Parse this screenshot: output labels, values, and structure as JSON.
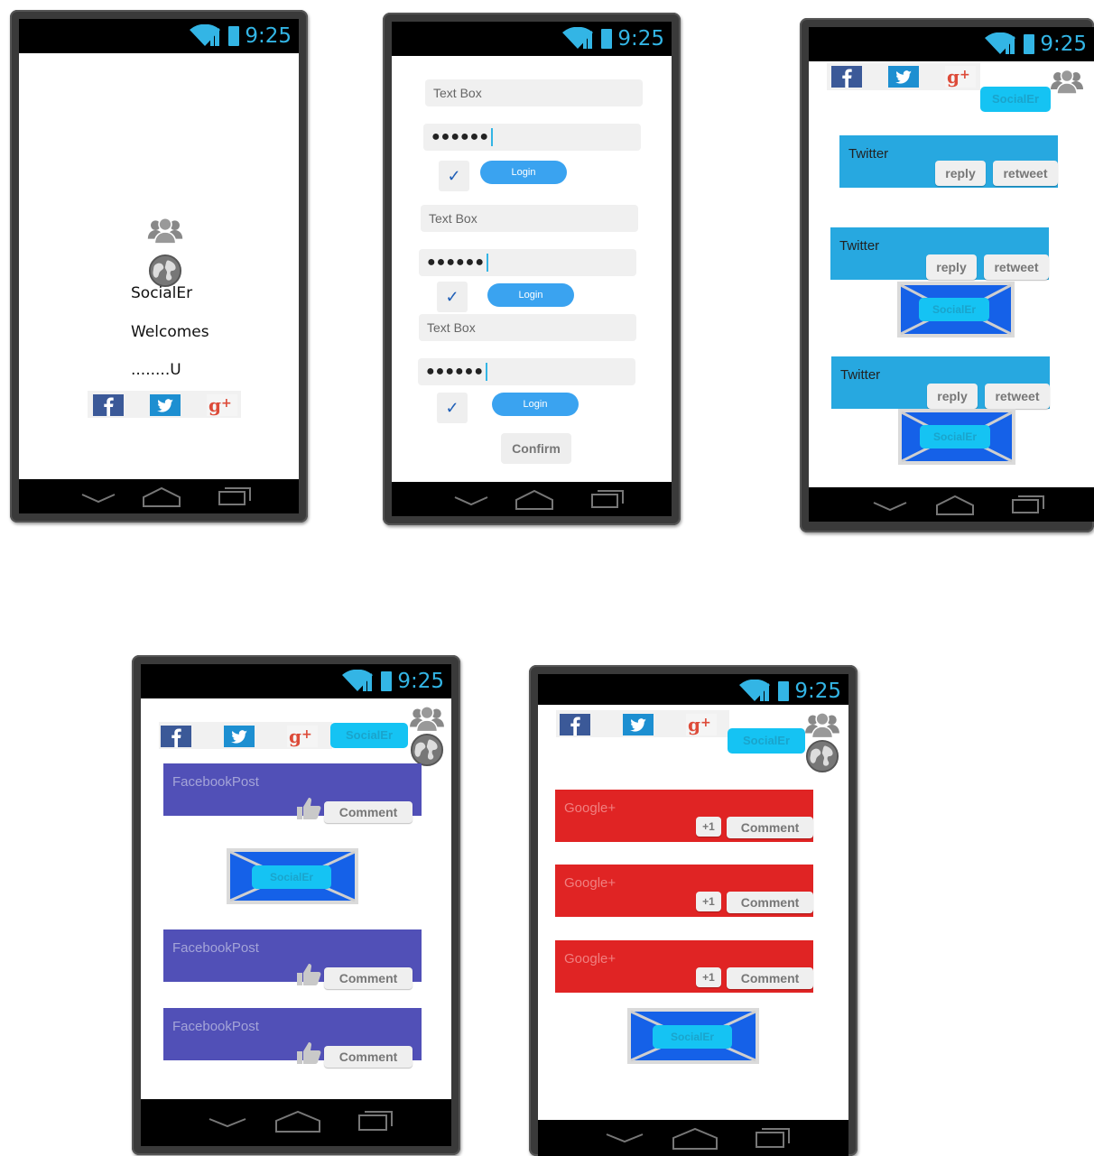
{
  "status_bar": {
    "time": "9:25"
  },
  "brand": "SocialEr",
  "colors": {
    "twitter": "#27a8e0",
    "facebook": "#5150b7",
    "google": "#e02424",
    "accent": "#33b5e5",
    "social_button": "#15c3f3"
  },
  "splash": {
    "title": "SocialEr",
    "line2": "Welcomes",
    "line3": "........U"
  },
  "login": {
    "groups": [
      {
        "username_placeholder": "Text Box",
        "password_mask": "●●●●●●",
        "checked": "✓",
        "login_label": "Login"
      },
      {
        "username_placeholder": "Text Box",
        "password_mask": "●●●●●●",
        "checked": "✓",
        "login_label": "Login"
      },
      {
        "username_placeholder": "Text Box",
        "password_mask": "●●●●●●",
        "checked": "✓",
        "login_label": "Login"
      }
    ],
    "confirm_label": "Confirm"
  },
  "twitter_feed": {
    "cards": [
      {
        "label": "Twitter",
        "reply": "reply",
        "retweet": "retweet"
      },
      {
        "label": "Twitter",
        "reply": "reply",
        "retweet": "retweet"
      },
      {
        "label": "Twitter",
        "reply": "reply",
        "retweet": "retweet"
      }
    ]
  },
  "facebook_feed": {
    "cards": [
      {
        "label": "FacebookPost",
        "comment": "Comment"
      },
      {
        "label": "FacebookPost",
        "comment": "Comment"
      },
      {
        "label": "FacebookPost",
        "comment": "Comment"
      }
    ]
  },
  "google_feed": {
    "cards": [
      {
        "label": "Google+",
        "plus": "+1",
        "comment": "Comment"
      },
      {
        "label": "Google+",
        "plus": "+1",
        "comment": "Comment"
      },
      {
        "label": "Google+",
        "plus": "+1",
        "comment": "Comment"
      }
    ]
  },
  "icons": {
    "facebook": "facebook-icon",
    "twitter": "twitter-icon",
    "googleplus": "google-plus-icon",
    "users": "users-icon",
    "globe": "globe-icon"
  }
}
